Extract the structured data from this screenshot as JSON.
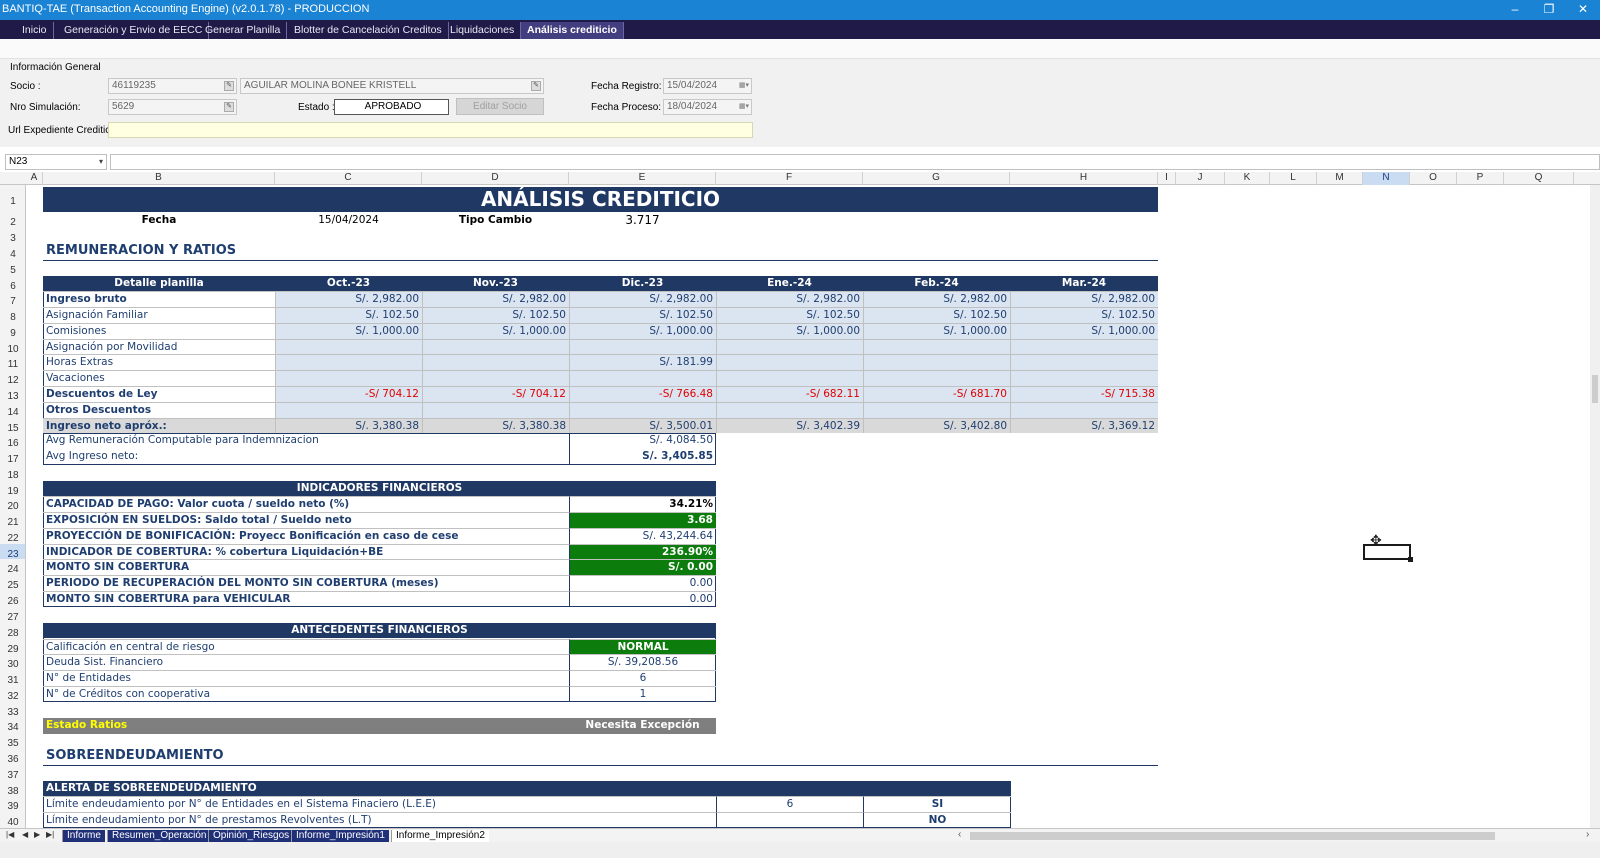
{
  "window": {
    "title": "BANTIQ-TAE (Transaction Accounting Engine) (v2.0.1.78) - PRODUCCION",
    "minimize": "–",
    "restore": "❐",
    "close": "✕"
  },
  "tabs": [
    "Inicio",
    "Generación y Envio de EECC",
    "Generar Planilla",
    "Blotter de Cancelación Creditos",
    "Liquidaciones",
    "Análisis crediticio"
  ],
  "tab_menu": "▼",
  "tab_close": "✕",
  "form": {
    "section": "Información General",
    "socio_label": "Socio :",
    "socio_id": "46119235",
    "socio_name": "AGUILAR MOLINA BONEE KRISTELL",
    "simulacion_label": "Nro Simulación:",
    "simulacion": "5629",
    "estado_label": "Estado :",
    "estado": "APROBADO",
    "editar_socio": "Editar Socio",
    "fecha_registro_label": "Fecha  Registro:",
    "fecha_registro": "15/04/2024",
    "fecha_proceso_label": "Fecha  Proceso:",
    "fecha_proceso": "18/04/2024",
    "url_label": "Url Expediente Crediticio:",
    "url": ""
  },
  "name_box": "N23",
  "columns": [
    "A",
    "B",
    "C",
    "D",
    "E",
    "F",
    "G",
    "H",
    "I",
    "J",
    "K",
    "L",
    "M",
    "N",
    "O",
    "P",
    "Q"
  ],
  "rows": [
    "1",
    "2",
    "3",
    "4",
    "5",
    "6",
    "7",
    "8",
    "9",
    "10",
    "11",
    "12",
    "13",
    "14",
    "15",
    "16",
    "17",
    "18",
    "19",
    "20",
    "21",
    "22",
    "23",
    "24",
    "25",
    "26",
    "27",
    "28",
    "29",
    "30",
    "31",
    "32",
    "33",
    "34",
    "35",
    "36",
    "37",
    "38",
    "39",
    "40"
  ],
  "sheet": {
    "title": "ANÁLISIS CREDITICIO",
    "fecha_label": "Fecha",
    "fecha": "15/04/2024",
    "tipo_cambio_label": "Tipo Cambio",
    "tipo_cambio": "3.717",
    "remuneracion_title": "REMUNERACIÓN Y RATIOS",
    "planilla_header": "Detalle planilla",
    "months": [
      "Oct.-23",
      "Nov.-23",
      "Dic.-23",
      "Ene.-24",
      "Feb.-24",
      "Mar.-24"
    ],
    "planilla_rows": [
      {
        "label": "Ingreso bruto",
        "bold": true,
        "neg": false,
        "values": [
          "S/. 2,982.00",
          "S/. 2,982.00",
          "S/. 2,982.00",
          "S/. 2,982.00",
          "S/. 2,982.00",
          "S/. 2,982.00"
        ]
      },
      {
        "label": "Asignación Familiar",
        "bold": false,
        "neg": false,
        "values": [
          "S/. 102.50",
          "S/. 102.50",
          "S/. 102.50",
          "S/. 102.50",
          "S/. 102.50",
          "S/. 102.50"
        ]
      },
      {
        "label": "Comisiones",
        "bold": false,
        "neg": false,
        "values": [
          "S/. 1,000.00",
          "S/. 1,000.00",
          "S/. 1,000.00",
          "S/. 1,000.00",
          "S/. 1,000.00",
          "S/. 1,000.00"
        ]
      },
      {
        "label": "Asignación por Movilidad",
        "bold": false,
        "neg": false,
        "values": [
          "",
          "",
          "",
          "",
          "",
          ""
        ]
      },
      {
        "label": "Horas Extras",
        "bold": false,
        "neg": false,
        "values": [
          "",
          "",
          "S/. 181.99",
          "",
          "",
          ""
        ]
      },
      {
        "label": "Vacaciones",
        "bold": false,
        "neg": false,
        "values": [
          "",
          "",
          "",
          "",
          "",
          ""
        ]
      },
      {
        "label": "Descuentos de Ley",
        "bold": true,
        "neg": true,
        "values": [
          "-S/ 704.12",
          "-S/ 704.12",
          "-S/ 766.48",
          "-S/ 682.11",
          "-S/ 681.70",
          "-S/ 715.38"
        ]
      },
      {
        "label": "Otros Descuentos",
        "bold": true,
        "neg": false,
        "values": [
          "",
          "",
          "",
          "",
          "",
          ""
        ]
      },
      {
        "label": "Ingreso neto apróx.:",
        "bold": true,
        "neg": false,
        "values": [
          "S/. 3,380.38",
          "S/. 3,380.38",
          "S/. 3,500.01",
          "S/. 3,402.39",
          "S/. 3,402.80",
          "S/. 3,369.12"
        ]
      }
    ],
    "avg_rem_label": "Avg Remuneración Computable para Indemnizacion",
    "avg_rem": "S/. 4,084.50",
    "avg_neto_label": "Avg Ingreso neto:",
    "avg_neto": "S/. 3,405.85",
    "indicadores_title": "INDICADORES FINANCIEROS",
    "indicadores": [
      {
        "label": "CAPACIDAD DE PAGO: Valor cuota / sueldo neto (%)",
        "value": "34.21%",
        "style": "bold"
      },
      {
        "label": "EXPOSICIÓN EN SUELDOS: Saldo total / Sueldo neto",
        "value": "3.68",
        "style": "green"
      },
      {
        "label": "PROYECCIÓN DE BONIFICACIÓN: Proyecc Bonificación en caso de cese",
        "value": "S/. 43,244.64",
        "style": "plain"
      },
      {
        "label": "INDICADOR DE COBERTURA: % cobertura Liquidación+BE",
        "value": "236.90%",
        "style": "green"
      },
      {
        "label": "MONTO SIN COBERTURA",
        "value": "S/. 0.00",
        "style": "green"
      },
      {
        "label": "PERIODO DE RECUPERACIÓN DEL MONTO SIN COBERTURA (meses)",
        "value": "0.00",
        "style": "plain"
      },
      {
        "label": "MONTO SIN COBERTURA para VEHICULAR",
        "value": "0.00",
        "style": "plain"
      }
    ],
    "antecedentes_title": "ANTECEDENTES FINANCIEROS",
    "antecedentes": [
      {
        "label": "Calificación en central de riesgo",
        "value": "NORMAL",
        "style": "green"
      },
      {
        "label": "Deuda Sist. Financiero",
        "value": "S/. 39,208.56",
        "style": "plain"
      },
      {
        "label": "N° de Entidades",
        "value": "6",
        "style": "plain"
      },
      {
        "label": "N° de Créditos con cooperativa",
        "value": "1",
        "style": "plain"
      }
    ],
    "estado_ratios_label": "Estado Ratios",
    "estado_ratios": "Necesita Excepción",
    "sobre_title": "SOBREENDEUDAMIENTO",
    "alerta_title": "ALERTA DE SOBREENDEUDAMIENTO",
    "alertas": [
      {
        "label": "Límite endeudamiento por N° de Entidades en el Sistema Finaciero (L.E.E)",
        "value": "6",
        "flag": "SI"
      },
      {
        "label": "Límite endeudamiento por N° de prestamos Revolventes (L.T)",
        "value": "",
        "flag": "NO"
      }
    ]
  },
  "sheet_tabs": [
    "Informe",
    "Resumen_Operación",
    "Opinión_Riesgos",
    "Informe_Impresión1",
    "Informe_Impresión2"
  ],
  "active_sheet_tab": "Informe_Impresión2",
  "colors": {
    "title_bar": "#1a83d4",
    "tab_bar": "#1f1a48",
    "navy": "#203864",
    "green": "#0c7d0c",
    "light_blue": "#dbe5f1",
    "negative": "#e00000",
    "estado_bar": "#7f7f7f",
    "estado_text": "#ffff00"
  }
}
